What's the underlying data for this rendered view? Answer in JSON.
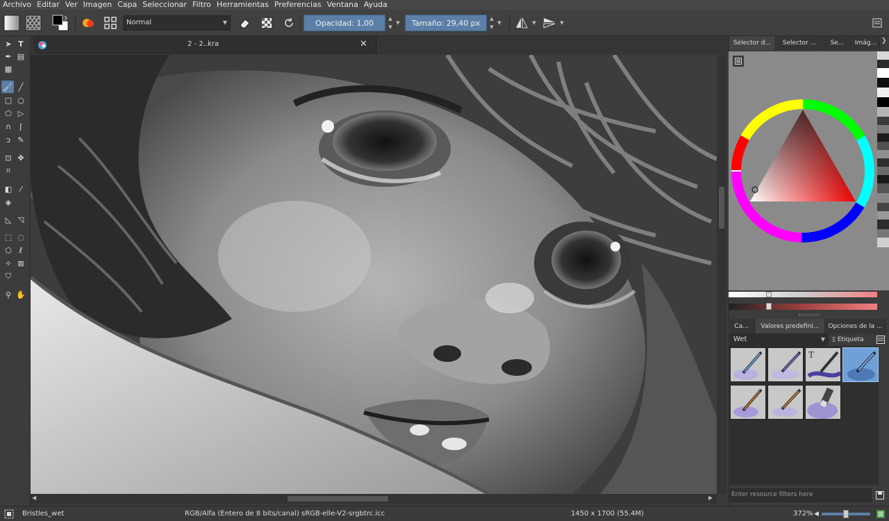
{
  "menu": [
    "Archivo",
    "Editar",
    "Ver",
    "Imagen",
    "Capa",
    "Seleccionar",
    "Filtro",
    "Herramientas",
    "Preferencias",
    "Ventana",
    "Ayuda"
  ],
  "toolbar": {
    "blend_mode": "Normal",
    "opacity_label": "Opacidad:",
    "opacity_value": "1,00",
    "size_label": "Tamaño:",
    "size_value": "29,40 px"
  },
  "document": {
    "tab_title": "2 - 2..kra"
  },
  "dock": {
    "top_tabs": [
      "Selector d...",
      "Selector ...",
      "Se...",
      "Imág..."
    ],
    "bottom_tabs": [
      "Ca...",
      "Valores predefini...",
      "Opciones de la ..."
    ],
    "preset_tag": "Wet",
    "tag_button": "Etiqueta",
    "filter_placeholder": "Enter resource filters here"
  },
  "status": {
    "preset_name": "Bristles_wet",
    "color_model": "RGB/Alfa (Entero de 8 bits/canal)  sRGB-elle-V2-srgbtrc.icc",
    "image_size": "1450 x 1700 (55.4M)",
    "zoom": "372%"
  },
  "colors": {
    "accent": "#5b7fa6",
    "panel": "#3c3c3c",
    "menu": "#474747"
  }
}
